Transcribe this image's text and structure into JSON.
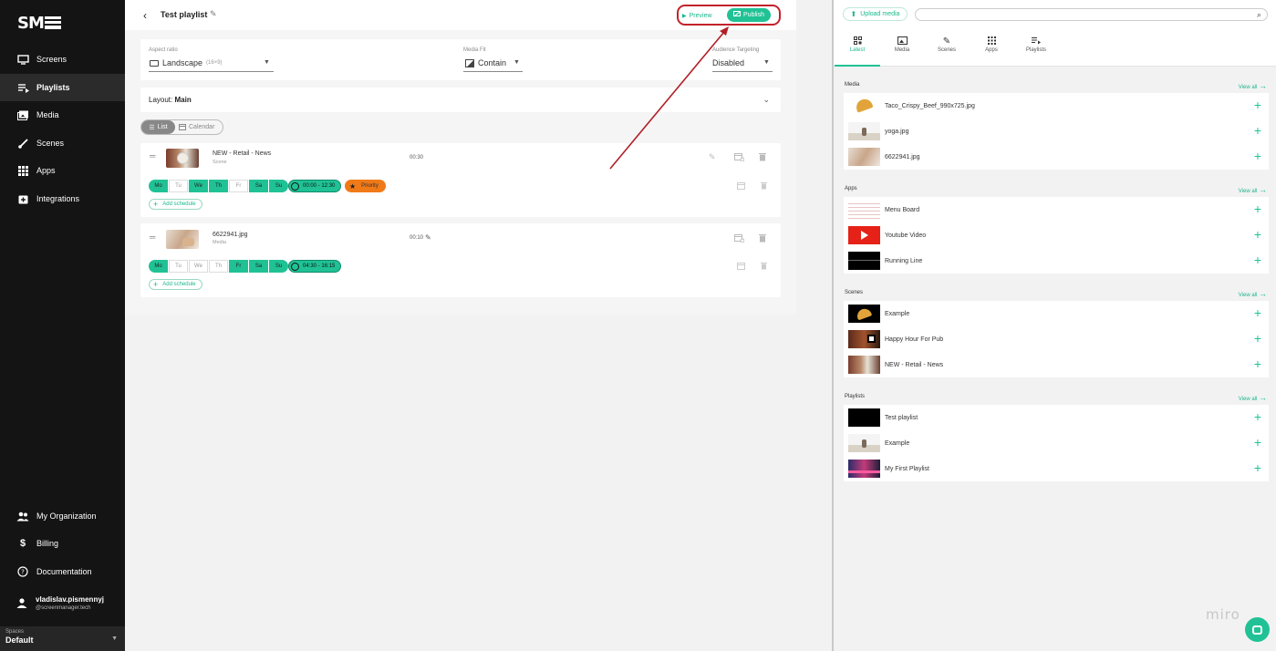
{
  "sidebar": {
    "logo": "SM",
    "nav": [
      {
        "label": "Screens",
        "icon": "monitor-icon"
      },
      {
        "label": "Playlists",
        "icon": "playlist-icon"
      },
      {
        "label": "Media",
        "icon": "media-icon"
      },
      {
        "label": "Scenes",
        "icon": "brush-icon"
      },
      {
        "label": "Apps",
        "icon": "grid-icon"
      },
      {
        "label": "Integrations",
        "icon": "integration-icon"
      }
    ],
    "bottom": [
      {
        "label": "My Organization",
        "icon": "people-icon"
      },
      {
        "label": "Billing",
        "icon": "dollar-icon"
      },
      {
        "label": "Documentation",
        "icon": "help-icon"
      }
    ],
    "user": {
      "name": "vladislav.pismennyj",
      "email": "@screenmanager.tech"
    },
    "spaces": {
      "label": "Spaces",
      "value": "Default"
    }
  },
  "header": {
    "title": "Test playlist",
    "preview_label": "Preview",
    "publish_label": "Publish"
  },
  "settings": {
    "aspect_label": "Aspect ratio",
    "aspect_value": "Landscape",
    "aspect_sub": "(16×9)",
    "fit_label": "Media Fit",
    "fit_value": "Contain",
    "targeting_label": "Audience Targeting",
    "targeting_value": "Disabled"
  },
  "layout": {
    "prefix": "Layout:",
    "name": "Main"
  },
  "view_toggle": {
    "list": "List",
    "calendar": "Calendar"
  },
  "items": [
    {
      "name": "NEW - Retail - News",
      "type": "Scene",
      "duration": "00:30",
      "days": [
        {
          "d": "Mo",
          "on": true
        },
        {
          "d": "Tu",
          "on": false
        },
        {
          "d": "We",
          "on": true
        },
        {
          "d": "Th",
          "on": true
        },
        {
          "d": "Fr",
          "on": false
        },
        {
          "d": "Sa",
          "on": true
        },
        {
          "d": "Su",
          "on": true
        }
      ],
      "time": "00:00 - 12:30",
      "priority": "Priority",
      "add_schedule": "Add schedule"
    },
    {
      "name": "6622941.jpg",
      "type": "Media",
      "duration": "00:10",
      "days": [
        {
          "d": "Mo",
          "on": true
        },
        {
          "d": "Tu",
          "on": false
        },
        {
          "d": "We",
          "on": false
        },
        {
          "d": "Th",
          "on": false
        },
        {
          "d": "Fr",
          "on": true
        },
        {
          "d": "Sa",
          "on": true
        },
        {
          "d": "Su",
          "on": true
        }
      ],
      "time": "04:30 - 16:15",
      "add_schedule": "Add schedule"
    }
  ],
  "panel": {
    "upload_label": "Upload media",
    "search_placeholder": "",
    "tabs": [
      "Latest",
      "Media",
      "Scenes",
      "Apps",
      "Playlists"
    ],
    "view_all": "View all",
    "sections": [
      {
        "title": "Media",
        "items": [
          "Taco_Crispy_Beef_990x725.jpg",
          "yoga.jpg",
          "6622941.jpg"
        ]
      },
      {
        "title": "Apps",
        "items": [
          "Menu Board",
          "Youtube Video",
          "Running Line"
        ]
      },
      {
        "title": "Scenes",
        "items": [
          "Example",
          "Happy Hour For Pub",
          "NEW - Retail - News"
        ]
      },
      {
        "title": "Playlists",
        "items": [
          "Test playlist",
          "Example",
          "My First Playlist"
        ]
      }
    ]
  },
  "watermark": "miro",
  "colors": {
    "accent": "#20c295",
    "highlight": "#c2222b",
    "priority": "#f07a18",
    "sidebar": "#141414"
  }
}
